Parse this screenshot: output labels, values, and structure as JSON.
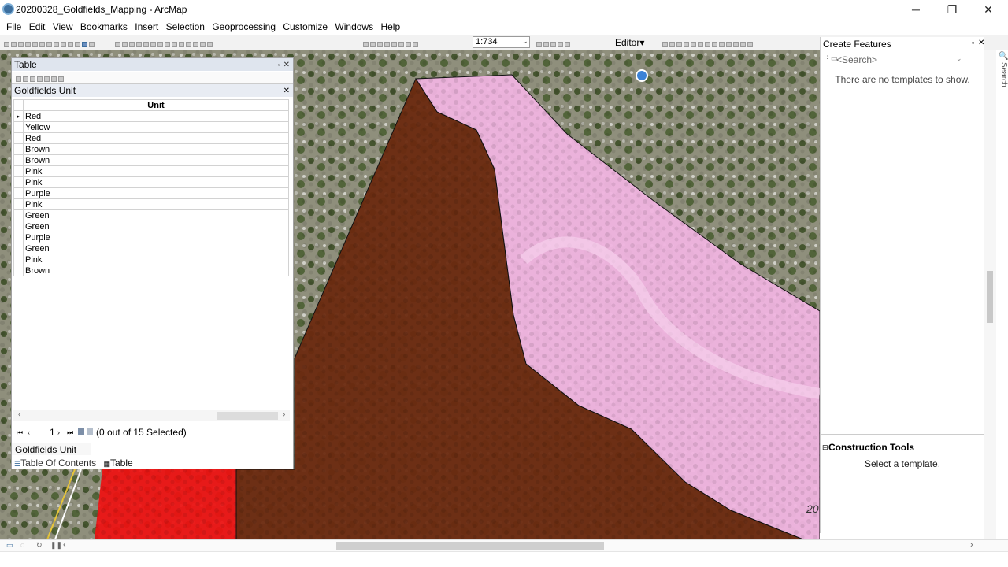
{
  "window": {
    "title": "20200328_Goldfields_Mapping - ArcMap"
  },
  "menu": [
    "File",
    "Edit",
    "View",
    "Bookmarks",
    "Insert",
    "Selection",
    "Geoprocessing",
    "Customize",
    "Windows",
    "Help"
  ],
  "toolbar": {
    "scale": "1:734",
    "editor_label": "Editor▾"
  },
  "table_window": {
    "caption": "Table",
    "layer_name": "Goldfields Unit",
    "column_header": "Unit",
    "rows": [
      "Red",
      "Yellow",
      "Red",
      "Brown",
      "Brown",
      "Pink",
      "Pink",
      "Purple",
      "Pink",
      "Green",
      "Green",
      "Purple",
      "Green",
      "Pink",
      "Brown"
    ],
    "page": "1",
    "selection_status": "(0 out of 15 Selected)",
    "layer_tab": "Goldfields Unit",
    "tabs": [
      "Table Of Contents",
      "Table"
    ]
  },
  "create_features": {
    "title": "Create Features",
    "search_placeholder": "<Search>",
    "empty_message": "There are no templates to show."
  },
  "construction_tools": {
    "title": "Construction Tools",
    "message": "Select a template."
  },
  "map": {
    "corner_label": "20"
  },
  "colors": {
    "brown": "#6b2a10",
    "pink": "#f0b4e0",
    "red": "#ee1111",
    "imagery": "#8a8a78"
  }
}
